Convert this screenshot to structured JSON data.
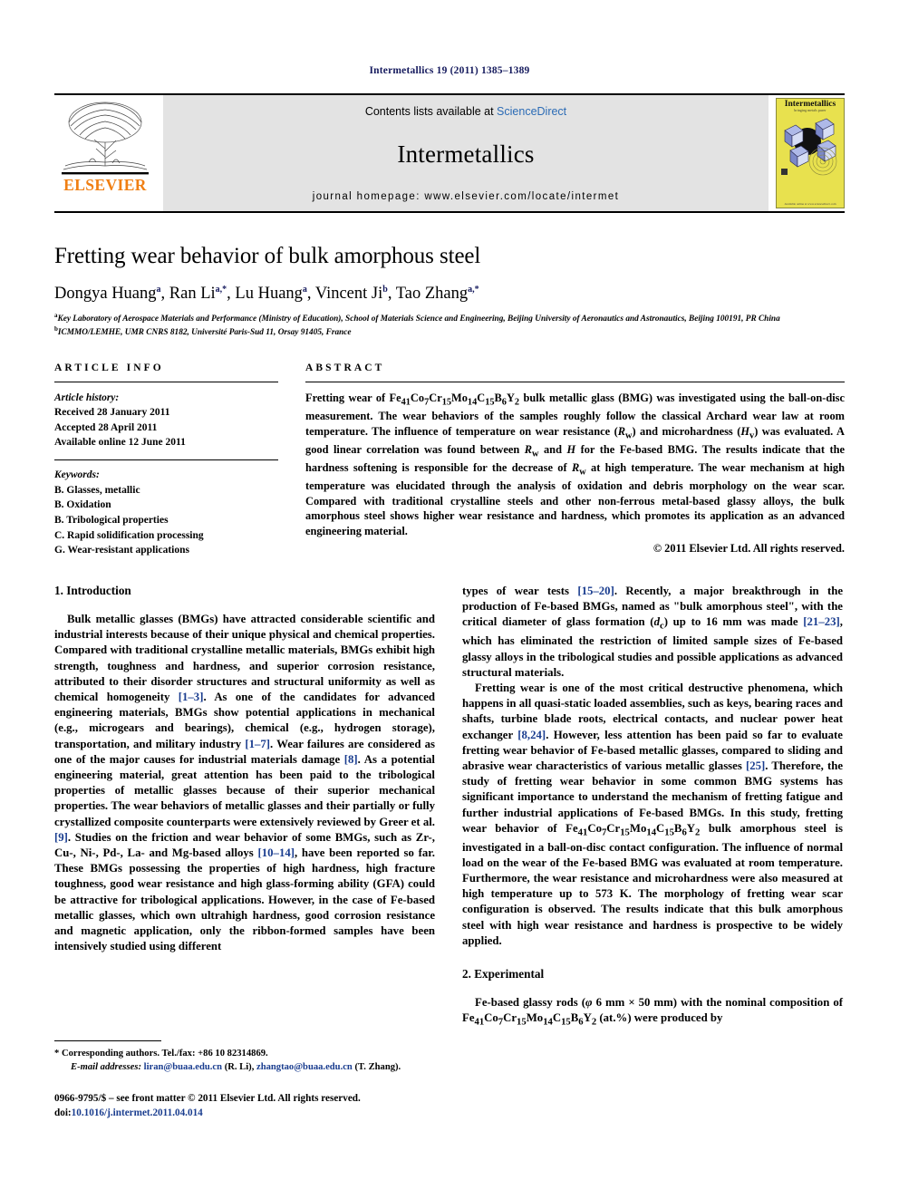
{
  "running_head": "Intermetallics 19 (2011) 1385–1389",
  "masthead": {
    "publisher": "ELSEVIER",
    "contents_prefix": "Contents lists available at ",
    "contents_link": "ScienceDirect",
    "journal_title": "Intermetallics",
    "homepage": "journal homepage: www.elsevier.com/locate/intermet",
    "cover": {
      "title": "Intermetallics",
      "subtitle": "bringing metals purer",
      "footer": "Editors\nC. T. Liu\nK. Hono\nM. Palm\nR. Mitra\nK. S. Kumar\nJ. Perepezko\nI. Baker\nTradley Jones\nvolume 2011"
    },
    "accent_blue": "#2b6bb5",
    "accent_orange": "#f07f13"
  },
  "article": {
    "title": "Fretting wear behavior of bulk amorphous steel",
    "authors": [
      {
        "name": "Dongya Huang",
        "sup": "a"
      },
      {
        "name": "Ran Li",
        "sup": "a,*"
      },
      {
        "name": "Lu Huang",
        "sup": "a"
      },
      {
        "name": "Vincent Ji",
        "sup": "b"
      },
      {
        "name": "Tao Zhang",
        "sup": "a,*"
      }
    ],
    "affiliations": [
      {
        "mark": "a",
        "text": "Key Laboratory of Aerospace Materials and Performance (Ministry of Education), School of Materials Science and Engineering, Beijing University of Aeronautics and Astronautics, Beijing 100191, PR China"
      },
      {
        "mark": "b",
        "text": "ICMMO/LEMHE, UMR CNRS 8182, Université Paris-Sud 11, Orsay 91405, France"
      }
    ]
  },
  "article_info": {
    "heading": "ARTICLE INFO",
    "history_label": "Article history:",
    "history": [
      "Received 28 January 2011",
      "Accepted 28 April 2011",
      "Available online 12 June 2011"
    ],
    "keywords_label": "Keywords:",
    "keywords": [
      "B. Glasses, metallic",
      "B. Oxidation",
      "B. Tribological properties",
      "C. Rapid solidification processing",
      "G. Wear-resistant applications"
    ]
  },
  "abstract": {
    "heading": "ABSTRACT",
    "copyright": "© 2011 Elsevier Ltd. All rights reserved."
  },
  "sections": {
    "introduction_heading": "1. Introduction",
    "experimental_heading": "2. Experimental"
  },
  "footnotes": {
    "corresponding": "* Corresponding authors. Tel./fax: +86 10 82314869.",
    "email_label": "E-mail addresses:",
    "email1": "liran@buaa.edu.cn",
    "email1_owner": "(R. Li)",
    "email2": "zhangtao@buaa.edu.cn",
    "email2_owner": "(T. Zhang)"
  },
  "colophon": {
    "issn_line": "0966-9795/$ – see front matter © 2011 Elsevier Ltd. All rights reserved.",
    "doi_label": "doi:",
    "doi_value": "10.1016/j.intermet.2011.04.014"
  }
}
